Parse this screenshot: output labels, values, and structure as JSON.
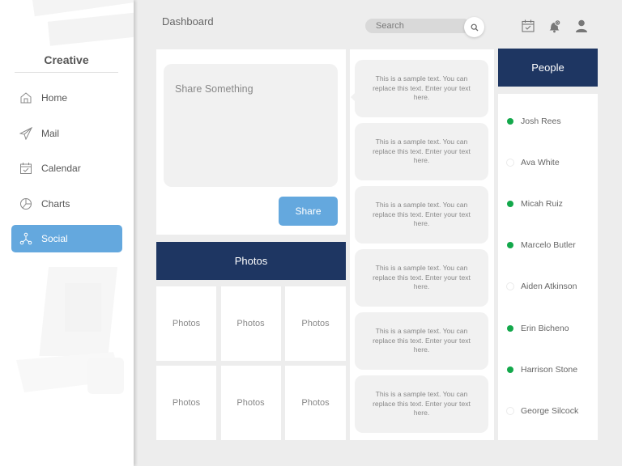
{
  "sidebar": {
    "brand": "Creative",
    "items": [
      {
        "label": "Home",
        "icon": "home-icon",
        "active": false
      },
      {
        "label": "Mail",
        "icon": "paper-plane-icon",
        "active": false
      },
      {
        "label": "Calendar",
        "icon": "calendar-icon",
        "active": false
      },
      {
        "label": "Charts",
        "icon": "pie-chart-icon",
        "active": false
      },
      {
        "label": "Social",
        "icon": "social-network-icon",
        "active": true
      }
    ]
  },
  "header": {
    "title": "Dashboard",
    "search": {
      "placeholder": "Search",
      "value": ""
    },
    "icons": [
      "calendar-check-icon",
      "notification-bell-icon",
      "user-icon"
    ]
  },
  "share": {
    "placeholder": "Share Something",
    "button_label": "Share"
  },
  "photos": {
    "title": "Photos",
    "tiles": [
      "Photos",
      "Photos",
      "Photos",
      "Photos",
      "Photos",
      "Photos"
    ]
  },
  "feed": {
    "items": [
      "This is a sample text. You can replace this text. Enter your text here.",
      "This is a sample text. You can replace this text. Enter your text here.",
      "This is a sample text. You can replace this text. Enter your text here.",
      "This is a sample text. You can replace this text. Enter your text here.",
      "This is a sample text. You can replace this text. Enter your text here.",
      "This is a sample text. You can replace this text. Enter your text here."
    ]
  },
  "people": {
    "title": "People",
    "list": [
      {
        "name": "Josh Rees",
        "status": "online"
      },
      {
        "name": "Ava White",
        "status": "offline"
      },
      {
        "name": "Micah Ruiz",
        "status": "online"
      },
      {
        "name": "Marcelo Butler",
        "status": "online"
      },
      {
        "name": "Aiden Atkinson",
        "status": "offline"
      },
      {
        "name": "Erin Bicheno",
        "status": "online"
      },
      {
        "name": "Harrison Stone",
        "status": "online"
      },
      {
        "name": "George Silcock",
        "status": "offline"
      }
    ]
  },
  "colors": {
    "accent": "#64a8de",
    "header_navy": "#1e3662",
    "online": "#13a84b",
    "background": "#ededed"
  }
}
